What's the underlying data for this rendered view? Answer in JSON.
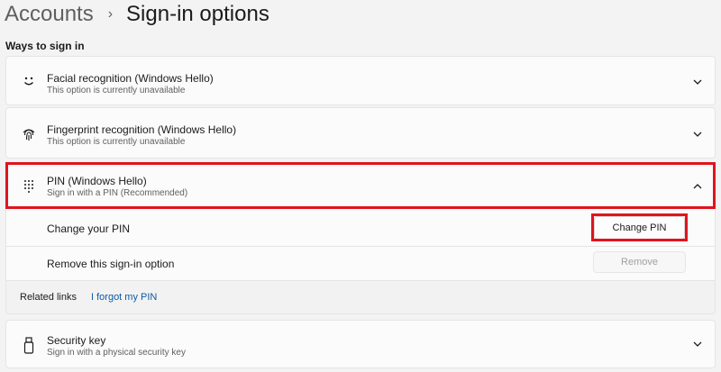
{
  "breadcrumb": {
    "parent": "Accounts",
    "separator": "›",
    "current": "Sign-in options"
  },
  "section_label": "Ways to sign in",
  "methods": [
    {
      "title": "Facial recognition (Windows Hello)",
      "subtitle": "This option is currently unavailable",
      "icon": "face-icon",
      "expanded": false
    },
    {
      "title": "Fingerprint recognition (Windows Hello)",
      "subtitle": "This option is currently unavailable",
      "icon": "fingerprint-icon",
      "expanded": false
    },
    {
      "title": "PIN (Windows Hello)",
      "subtitle": "Sign in with a PIN (Recommended)",
      "icon": "keypad-icon",
      "expanded": true
    },
    {
      "title": "Security key",
      "subtitle": "Sign in with a physical security key",
      "icon": "usb-key-icon",
      "expanded": false
    }
  ],
  "pin": {
    "change_label": "Change your PIN",
    "change_button": "Change PIN",
    "remove_label": "Remove this sign-in option",
    "remove_button": "Remove"
  },
  "related": {
    "label": "Related links",
    "link": "I forgot my PIN"
  },
  "colors": {
    "highlight": "#e0141e",
    "link": "#0f5aa6",
    "background": "#f3f3f3",
    "card": "#fbfbfb"
  }
}
